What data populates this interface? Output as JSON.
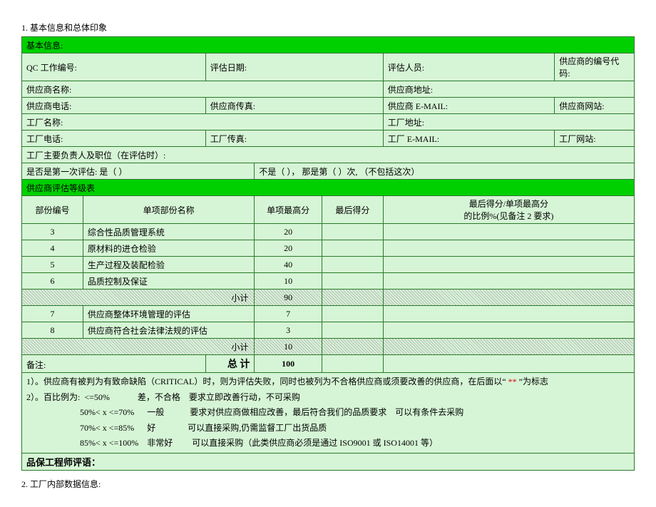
{
  "heading1": "1.   基本信息和总体印象",
  "basicInfo": {
    "header": "基本信息:",
    "row1": {
      "c1": "QC 工作编号:",
      "c2": "评估日期:",
      "c3": "评估人员:",
      "c4": "供应商的编号代码:"
    },
    "row2": {
      "c1": "供应商名称:",
      "c2": "供应商地址:"
    },
    "row3": {
      "c1": "供应商电话:",
      "c2": "供应商传真:",
      "c3": "供应商 E-MAIL:",
      "c4": "供应商网站:"
    },
    "row4": {
      "c1": "工厂名称:",
      "c2": "工厂地址:"
    },
    "row5": {
      "c1": "工厂电话:",
      "c2": "工厂传真:",
      "c3": "工厂 E-MAIL:",
      "c4": "工厂网站:"
    },
    "row6": "工厂主要负责人及职位（在评估时）:",
    "row7a": "是否是第一次评估:      是（      ）",
    "row7b": "不是（       ），   那是第（       ）次, （不包括这次）"
  },
  "grade": {
    "header": "供应商评估等级表",
    "cols": {
      "c1": "部份编号",
      "c2": "单项部份名称",
      "c3": "单项最高分",
      "c4": "最后得分",
      "c5a": "最后得分/单项最高分",
      "c5b": "的比例%(见备注 2 要求)"
    },
    "rows": [
      {
        "no": "3",
        "name": "综合性品质管理系统",
        "max": "20"
      },
      {
        "no": "4",
        "name": "原材料的进仓检验",
        "max": "20"
      },
      {
        "no": "5",
        "name": "生产过程及装配检验",
        "max": "40"
      },
      {
        "no": "6",
        "name": "品质控制及保证",
        "max": "10"
      }
    ],
    "subtotal1": {
      "label": "小计",
      "val": "90"
    },
    "rows2": [
      {
        "no": "7",
        "name": "供应商整体环境管理的评估",
        "max": "7"
      },
      {
        "no": "8",
        "name": "供应商符合社会法律法规的评估",
        "max": "3"
      }
    ],
    "subtotal2": {
      "label": "小计",
      "val": "10"
    },
    "total": {
      "noteLabel": "备注:",
      "label": "总 计",
      "val": "100"
    }
  },
  "notes": {
    "l1a": "1）。供应商有被判为有致命缺陷（CRITICAL）时，则为评估失败，同时也被列为不合格供应商或须要改善的供应商，在后面以“ ",
    "l1star": "**",
    "l1b": " ”为标志",
    "l2": "2）。百比例为:  <=50%             差，不合格    要求立即改善行动，不可采购",
    "l3": "                         50%< x <=70%      一般            要求对供应商做相应改善，最后符合我们的品质要求    可以有条件去采购",
    "l4": "                         70%< x <=85%      好               可以直接采购,仍需监督工厂出货品质",
    "l5": "                         85%< x <=100%    非常好         可以直接采购（此类供应商必须是通过 ISO9001 或 ISO14001 等）"
  },
  "engineerComment": "品保工程师评语：",
  "heading2": "2.    工厂内部数据信息:"
}
